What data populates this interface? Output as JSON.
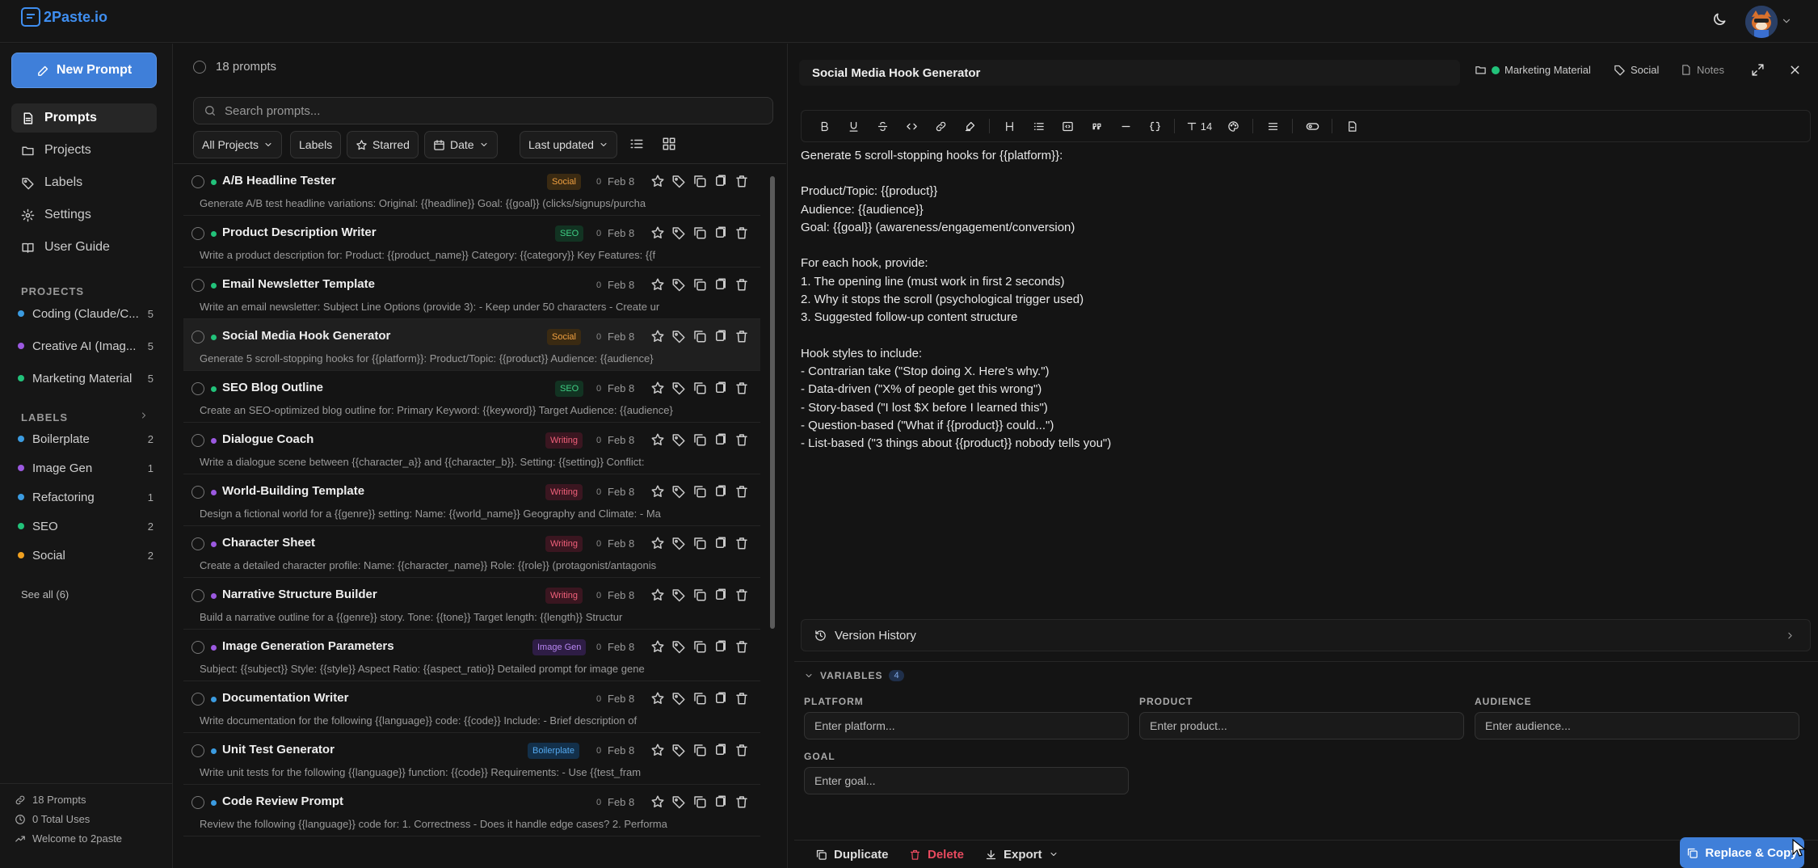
{
  "app": {
    "name": "2Paste.io"
  },
  "sidebar": {
    "new_prompt": "New Prompt",
    "nav": [
      {
        "label": "Prompts",
        "icon": "document-icon",
        "active": true
      },
      {
        "label": "Projects",
        "icon": "folder-icon"
      },
      {
        "label": "Labels",
        "icon": "tag-icon"
      },
      {
        "label": "Settings",
        "icon": "gear-icon"
      },
      {
        "label": "User Guide",
        "icon": "book-icon"
      }
    ],
    "projects_heading": "PROJECTS",
    "projects": [
      {
        "name": "Coding (Claude/C...",
        "count": "5",
        "color": "#3b9be0"
      },
      {
        "name": "Creative AI (Imag...",
        "count": "5",
        "color": "#9b59e0"
      },
      {
        "name": "Marketing Material",
        "count": "5",
        "color": "#22c27a"
      }
    ],
    "labels_heading": "LABELS",
    "labels": [
      {
        "name": "Boilerplate",
        "count": "2",
        "color": "#3b9be0"
      },
      {
        "name": "Image Gen",
        "count": "1",
        "color": "#9b59e0"
      },
      {
        "name": "Refactoring",
        "count": "1",
        "color": "#3b9be0"
      },
      {
        "name": "SEO",
        "count": "2",
        "color": "#22c27a"
      },
      {
        "name": "Social",
        "count": "2",
        "color": "#f0a020"
      }
    ],
    "see_all": "See all (6)",
    "footer": {
      "prompts": "18 Prompts",
      "uses": "0 Total Uses",
      "welcome": "Welcome to 2paste"
    }
  },
  "list": {
    "count_label": "18 prompts",
    "search_placeholder": "Search prompts...",
    "filters": {
      "projects": "All Projects",
      "labels": "Labels",
      "starred": "Starred",
      "date": "Date",
      "sort": "Last updated"
    },
    "items": [
      {
        "title": "A/B Headline Tester",
        "badge": "Social",
        "date": "Feb 8",
        "uses": "0",
        "dot": "#22c27a",
        "preview": "Generate A/B test headline variations: Original: {{headline}} Goal: {{goal}} (clicks/signups/purcha"
      },
      {
        "title": "Product Description Writer",
        "badge": "SEO",
        "date": "Feb 8",
        "uses": "0",
        "dot": "#22c27a",
        "preview": "Write a product description for: Product: {{product_name}} Category: {{category}} Key Features: {{f"
      },
      {
        "title": "Email Newsletter Template",
        "badge": "",
        "date": "Feb 8",
        "uses": "0",
        "dot": "#22c27a",
        "preview": "Write an email newsletter: Subject Line Options (provide 3): - Keep under 50 characters - Create ur"
      },
      {
        "title": "Social Media Hook Generator",
        "badge": "Social",
        "date": "Feb 8",
        "uses": "0",
        "dot": "#22c27a",
        "preview": "Generate 5 scroll-stopping hooks for {{platform}}: Product/Topic: {{product}} Audience: {{audience}"
      },
      {
        "title": "SEO Blog Outline",
        "badge": "SEO",
        "date": "Feb 8",
        "uses": "0",
        "dot": "#22c27a",
        "preview": "Create an SEO-optimized blog outline for: Primary Keyword: {{keyword}} Target Audience: {{audience}"
      },
      {
        "title": "Dialogue Coach",
        "badge": "Writing",
        "date": "Feb 8",
        "uses": "0",
        "dot": "#9b59e0",
        "preview": "Write a dialogue scene between {{character_a}} and {{character_b}}. Setting: {{setting}} Conflict:"
      },
      {
        "title": "World-Building Template",
        "badge": "Writing",
        "date": "Feb 8",
        "uses": "0",
        "dot": "#9b59e0",
        "preview": "Design a fictional world for a {{genre}} setting: Name: {{world_name}} Geography and Climate: - Ma"
      },
      {
        "title": "Character Sheet",
        "badge": "Writing",
        "date": "Feb 8",
        "uses": "0",
        "dot": "#9b59e0",
        "preview": "Create a detailed character profile: Name: {{character_name}} Role: {{role}} (protagonist/antagonis"
      },
      {
        "title": "Narrative Structure Builder",
        "badge": "Writing",
        "date": "Feb 8",
        "uses": "0",
        "dot": "#9b59e0",
        "preview": "Build a narrative outline for a {{genre}} story. Tone: {{tone}} Target length: {{length}} Structur"
      },
      {
        "title": "Image Generation Parameters",
        "badge": "Image Gen",
        "date": "Feb 8",
        "uses": "0",
        "dot": "#9b59e0",
        "preview": "Subject: {{subject}} Style: {{style}} Aspect Ratio: {{aspect_ratio}} Detailed prompt for image gene"
      },
      {
        "title": "Documentation Writer",
        "badge": "",
        "date": "Feb 8",
        "uses": "0",
        "dot": "#3b9be0",
        "preview": "Write documentation for the following {{language}} code: {{code}} Include: - Brief description of"
      },
      {
        "title": "Unit Test Generator",
        "badge": "Boilerplate",
        "date": "Feb 8",
        "uses": "0",
        "dot": "#3b9be0",
        "preview": "Write unit tests for the following {{language}} function: {{code}} Requirements: - Use {{test_fram"
      },
      {
        "title": "Code Review Prompt",
        "badge": "",
        "date": "Feb 8",
        "uses": "0",
        "dot": "#3b9be0",
        "preview": "Review the following {{language}} code for: 1. Correctness - Does it handle edge cases? 2. Performa"
      }
    ]
  },
  "editor": {
    "title": "Social Media Hook Generator",
    "project": "Marketing Material",
    "label": "Social",
    "notes": "Notes",
    "font_size": "14",
    "content": [
      "Generate 5 scroll-stopping hooks for {{platform}}:",
      "",
      "Product/Topic: {{product}}",
      "Audience: {{audience}}",
      "Goal: {{goal}} (awareness/engagement/conversion)",
      "",
      "For each hook, provide:",
      "1. The opening line (must work in first 2 seconds)",
      "2. Why it stops the scroll (psychological trigger used)",
      "3. Suggested follow-up content structure",
      "",
      "Hook styles to include:",
      "- Contrarian take (\"Stop doing X. Here's why.\")",
      "- Data-driven (\"X% of people get this wrong\")",
      "- Story-based (\"I lost $X before I learned this\")",
      "- Question-based (\"What if {{product}} could...\")",
      "- List-based (\"3 things about {{product}} nobody tells you\")"
    ],
    "version_history": "Version History",
    "variables": {
      "heading": "VARIABLES",
      "count": "4",
      "fields": [
        {
          "label": "PLATFORM",
          "placeholder": "Enter platform..."
        },
        {
          "label": "PRODUCT",
          "placeholder": "Enter product..."
        },
        {
          "label": "AUDIENCE",
          "placeholder": "Enter audience..."
        },
        {
          "label": "GOAL",
          "placeholder": "Enter goal..."
        }
      ]
    },
    "footer": {
      "duplicate": "Duplicate",
      "delete": "Delete",
      "export": "Export",
      "replace_copy": "Replace & Copy"
    }
  },
  "badge_styles": {
    "Social": {
      "bg": "#3a2a12",
      "fg": "#f0a040"
    },
    "SEO": {
      "bg": "#123322",
      "fg": "#3fcf84"
    },
    "Writing": {
      "bg": "#3a1620",
      "fg": "#f0607a"
    },
    "Image Gen": {
      "bg": "#2e1d45",
      "fg": "#b685f0"
    },
    "Boilerplate": {
      "bg": "#13304a",
      "fg": "#55aaf0"
    }
  }
}
